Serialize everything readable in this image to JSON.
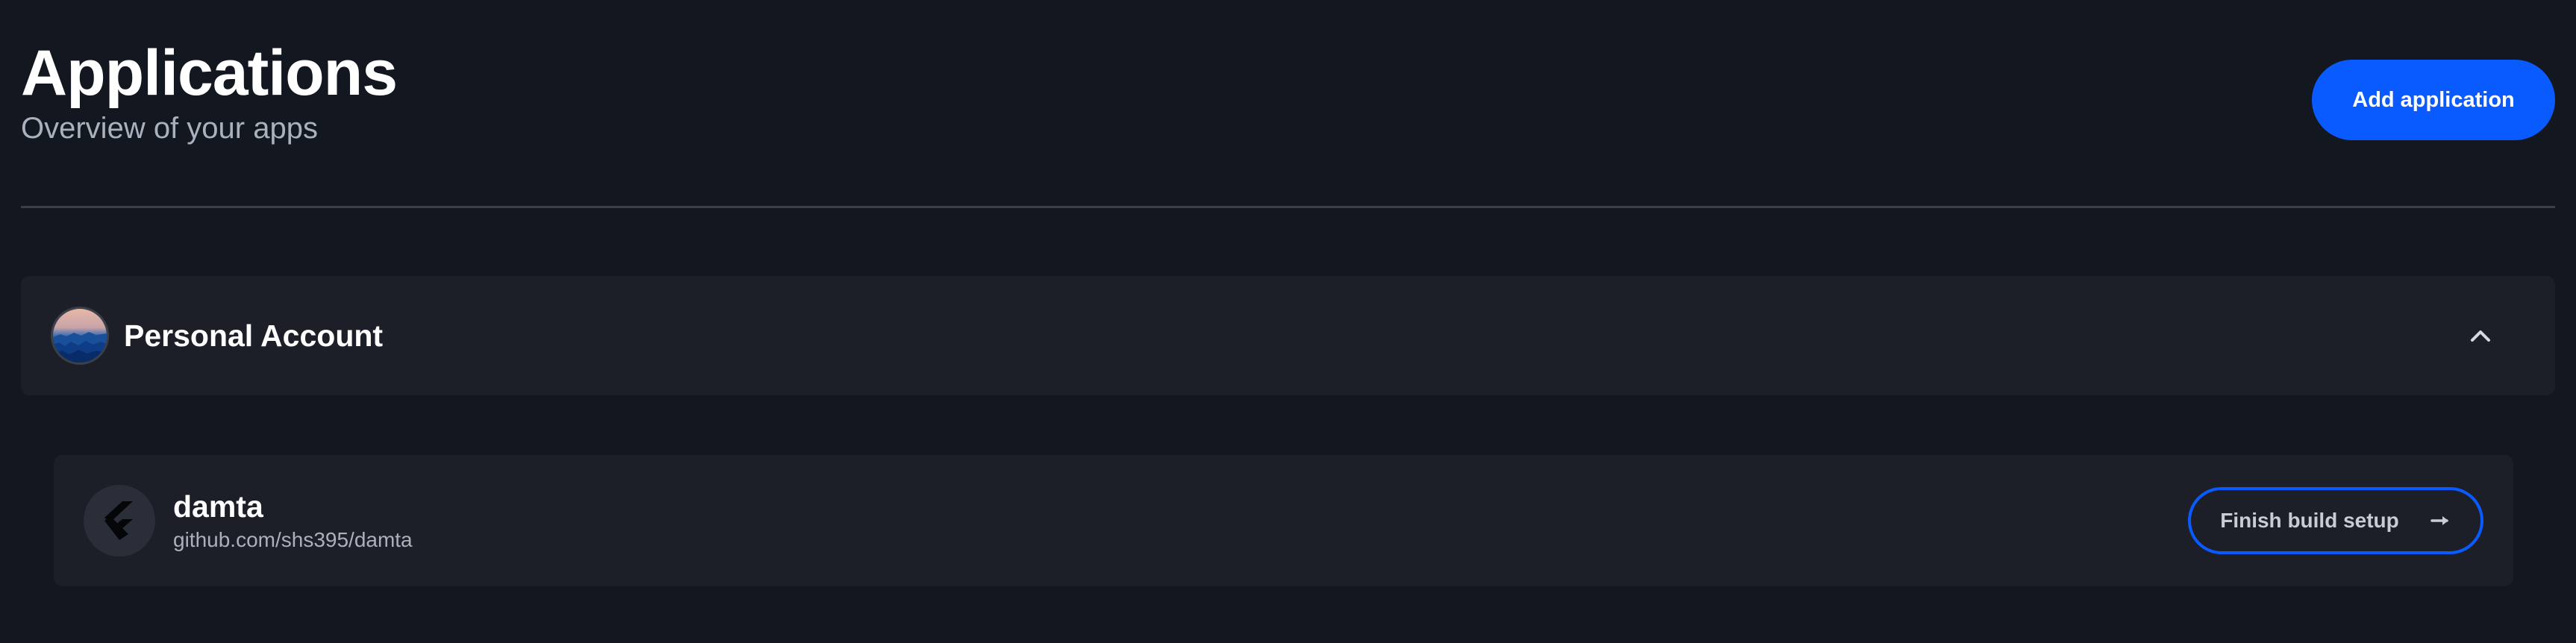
{
  "header": {
    "title": "Applications",
    "subtitle": "Overview of your apps",
    "add_button_label": "Add application"
  },
  "account": {
    "name": "Personal Account",
    "avatar_icon": "avatar-image",
    "toggle_icon": "chevron-up-icon"
  },
  "apps": [
    {
      "name": "damta",
      "repo": "github.com/shs395/damta",
      "icon": "flutter-icon",
      "action_label": "Finish build setup",
      "action_icon": "arrow-right-icon"
    }
  ],
  "colors": {
    "background": "#131720",
    "panel": "#1c1f27",
    "accent": "#0a5bff",
    "muted_text": "#aab0bd"
  }
}
